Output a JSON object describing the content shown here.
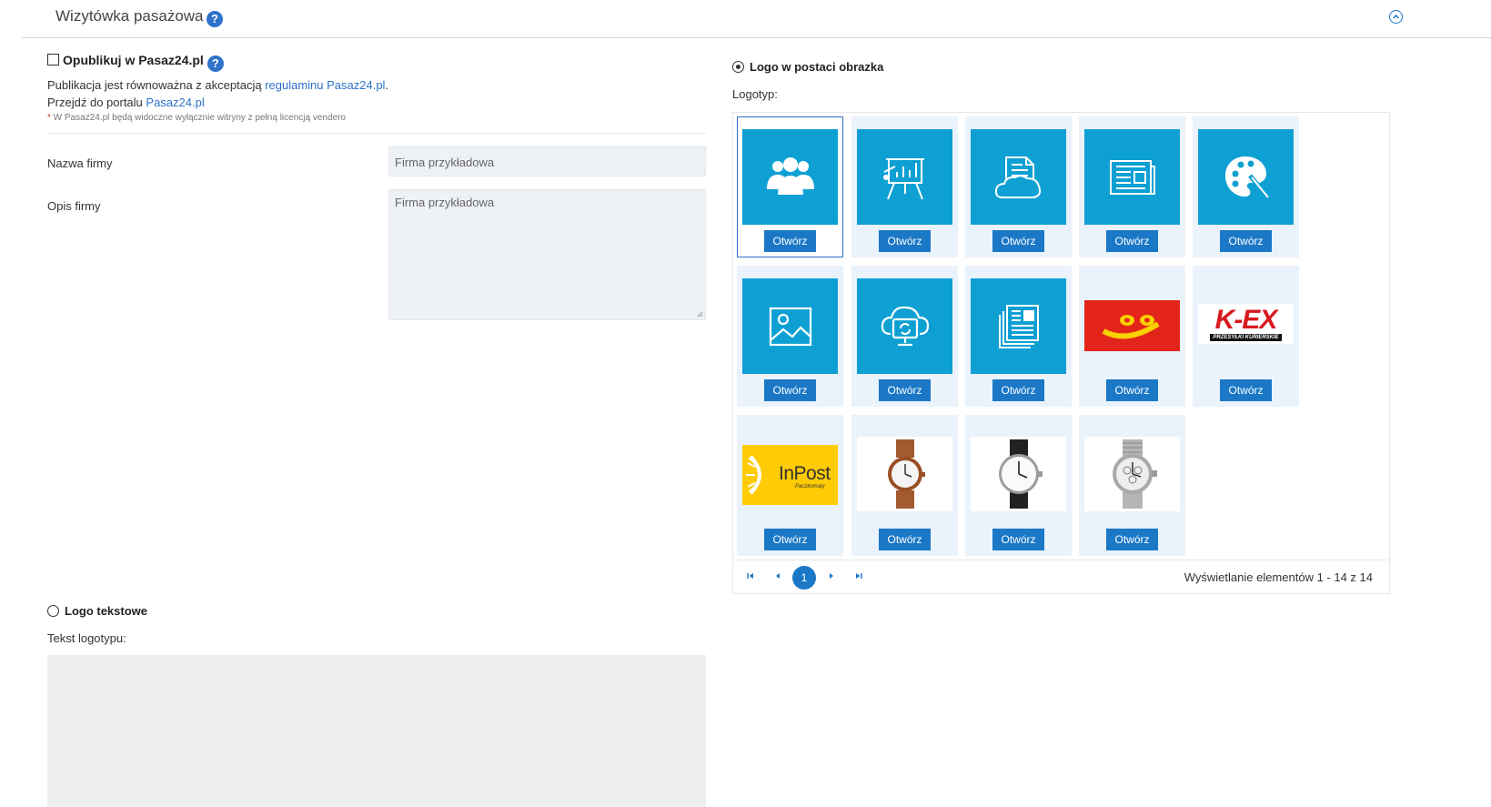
{
  "header": {
    "title": "Wizytówka pasażowa",
    "help": "?"
  },
  "publish": {
    "label": "Opublikuj w Pasaz24.pl",
    "help": "?",
    "line1_prefix": "Publikacja jest równoważna z akceptacją ",
    "line1_link": "regulaminu Pasaz24.pl",
    "line1_suffix": ".",
    "line2_prefix": "Przejdź do portalu ",
    "line2_link": "Pasaz24.pl",
    "note_star": "*",
    "note": " W Pasaz24.pl będą widoczne wyłącznie witryny z pełną licencją vendero"
  },
  "form": {
    "company_name_label": "Nazwa firmy",
    "company_name_value": "Firma przykładowa",
    "company_desc_label": "Opis firmy",
    "company_desc_value": "Firma przykładowa"
  },
  "text_logo": {
    "label": "Logo tekstowe",
    "field_label": "Tekst logotypu:"
  },
  "image_logo": {
    "label": "Logo w postaci obrazka",
    "field_label": "Logotyp:",
    "open_label": "Otwórz",
    "tiles": [
      {
        "icon": "people-icon"
      },
      {
        "icon": "presentation-board-icon"
      },
      {
        "icon": "cloud-document-icon"
      },
      {
        "icon": "newspaper-icon"
      },
      {
        "icon": "palette-icon"
      },
      {
        "icon": "image-icon"
      },
      {
        "icon": "cloud-monitor-icon"
      },
      {
        "icon": "documents-icon"
      },
      {
        "icon": "poczta-polska-logo"
      },
      {
        "icon": "kex-logo",
        "text": "K-EX",
        "subtext": "PRZESYŁKI KURIERSKIE"
      },
      {
        "icon": "inpost-logo",
        "text": "InPost",
        "subtext": "Paczkomaty"
      },
      {
        "icon": "brown-watch-image"
      },
      {
        "icon": "black-watch-image"
      },
      {
        "icon": "steel-watch-image"
      }
    ],
    "pager": {
      "current": "1",
      "info": "Wyświetlanie elementów 1 - 14 z 14"
    }
  },
  "colors": {
    "accent": "#1b78c6",
    "tile_blue": "#0ea0d3",
    "tile_bg": "#eaf2fb"
  }
}
